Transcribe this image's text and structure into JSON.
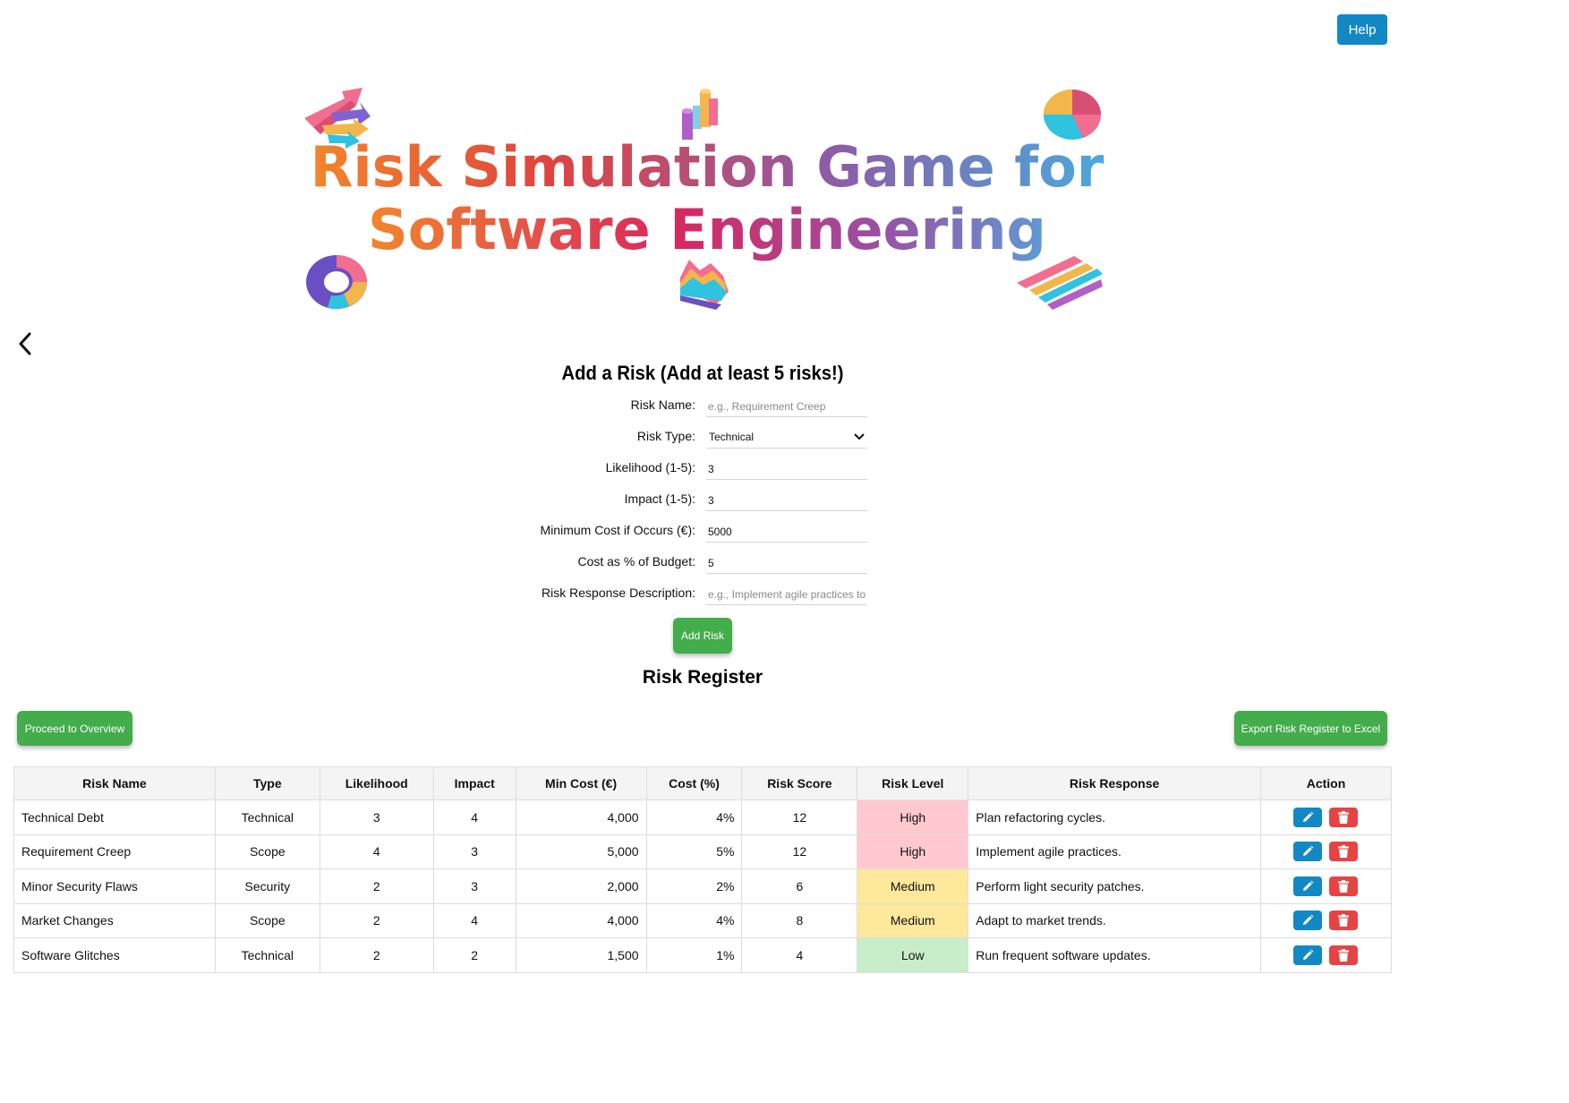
{
  "header": {
    "help_label": "Help"
  },
  "banner": {
    "title_line1": "Risk Simulation Game for",
    "title_line2": "Software Engineering"
  },
  "form": {
    "title": "Add a Risk (Add at least 5 risks!)",
    "risk_name": {
      "label": "Risk Name:",
      "placeholder": "e.g., Requirement Creep",
      "value": ""
    },
    "risk_type": {
      "label": "Risk Type:",
      "value": "Technical"
    },
    "likelihood": {
      "label": "Likelihood (1-5):",
      "value": "3"
    },
    "impact": {
      "label": "Impact (1-5):",
      "value": "3"
    },
    "min_cost": {
      "label": "Minimum Cost if Occurs (€):",
      "value": "5000"
    },
    "cost_pct": {
      "label": "Cost as % of Budget:",
      "value": "5"
    },
    "response": {
      "label": "Risk Response Description:",
      "placeholder": "e.g., Implement agile practices to",
      "value": ""
    },
    "add_label": "Add Risk"
  },
  "register": {
    "title": "Risk Register",
    "proceed_label": "Proceed to Overview",
    "export_label": "Export Risk Register to Excel",
    "columns": [
      "Risk Name",
      "Type",
      "Likelihood",
      "Impact",
      "Min Cost (€)",
      "Cost (%)",
      "Risk Score",
      "Risk Level",
      "Risk Response",
      "Action"
    ],
    "rows": [
      {
        "name": "Technical Debt",
        "type": "Technical",
        "likelihood": "3",
        "impact": "4",
        "min_cost": "4,000",
        "cost_pct": "4%",
        "score": "12",
        "level": "High",
        "response": "Plan refactoring cycles."
      },
      {
        "name": "Requirement Creep",
        "type": "Scope",
        "likelihood": "4",
        "impact": "3",
        "min_cost": "5,000",
        "cost_pct": "5%",
        "score": "12",
        "level": "High",
        "response": "Implement agile practices."
      },
      {
        "name": "Minor Security Flaws",
        "type": "Security",
        "likelihood": "2",
        "impact": "3",
        "min_cost": "2,000",
        "cost_pct": "2%",
        "score": "6",
        "level": "Medium",
        "response": "Perform light security patches."
      },
      {
        "name": "Market Changes",
        "type": "Scope",
        "likelihood": "2",
        "impact": "4",
        "min_cost": "4,000",
        "cost_pct": "4%",
        "score": "8",
        "level": "Medium",
        "response": "Adapt to market trends."
      },
      {
        "name": "Software Glitches",
        "type": "Technical",
        "likelihood": "2",
        "impact": "2",
        "min_cost": "1,500",
        "cost_pct": "1%",
        "score": "4",
        "level": "Low",
        "response": "Run frequent software updates."
      }
    ]
  },
  "colors": {
    "accent_blue": "#1288c4",
    "accent_green": "#43ac4b",
    "delete_red": "#e84343",
    "level_high": "#ffc9cf",
    "level_medium": "#fde89c",
    "level_low": "#c7eec9"
  },
  "icons": [
    "back-chevron-icon",
    "chevron-down-icon",
    "pencil-icon",
    "trash-icon",
    "arrows-icon",
    "bar-chart-icon",
    "pie-chart-icon",
    "donut-chart-icon",
    "wave-chart-icon",
    "stacked-bars-icon"
  ]
}
